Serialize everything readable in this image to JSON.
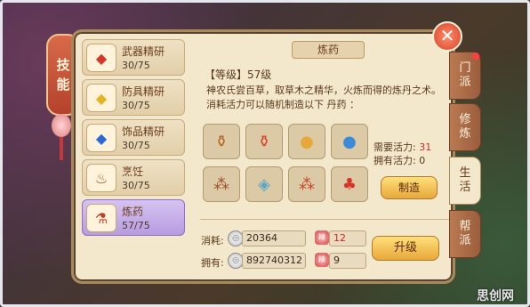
{
  "banner": {
    "label_1": "技",
    "label_2": "能"
  },
  "skills": [
    {
      "name": "武器精研",
      "level": "30/75",
      "icon": "red-gem-icon"
    },
    {
      "name": "防具精研",
      "level": "30/75",
      "icon": "yellow-gem-icon"
    },
    {
      "name": "饰品精研",
      "level": "30/75",
      "icon": "blue-gem-icon"
    },
    {
      "name": "烹饪",
      "level": "30/75",
      "icon": "cooking-pot-icon"
    },
    {
      "name": "炼药",
      "level": "57/75",
      "icon": "alchemy-cauldron-icon",
      "active": true
    }
  ],
  "detail": {
    "title": "炼药",
    "grade": "【等级】57级",
    "desc_line1": "神农氏尝百草，取草木之精华，火炼而得的炼丹之术。",
    "desc_line2": "消耗活力可以随机制造以下  丹药  ："
  },
  "vitality": {
    "need_label": "需要活力:",
    "need_value": "31",
    "have_label": "拥有活力:",
    "have_value": "0"
  },
  "buttons": {
    "make": "制造",
    "upgrade": "升级",
    "close": "✕"
  },
  "cost": {
    "consume_label": "消耗:",
    "consume_silver": "20364",
    "consume_gem": "12",
    "own_label": "拥有:",
    "own_silver": "892740312",
    "own_gem": "9",
    "gem_icon_text": "精"
  },
  "tabs": [
    {
      "label_1": "门",
      "label_2": "派"
    },
    {
      "label_1": "修",
      "label_2": "炼"
    },
    {
      "label_1": "生",
      "label_2": "活"
    },
    {
      "label_1": "帮",
      "label_2": "派"
    }
  ],
  "watermark": "思创网",
  "colors": {
    "accent_red": "#d02a2a",
    "active_skill": "#b79be0",
    "panel": "#f3e7cc"
  }
}
